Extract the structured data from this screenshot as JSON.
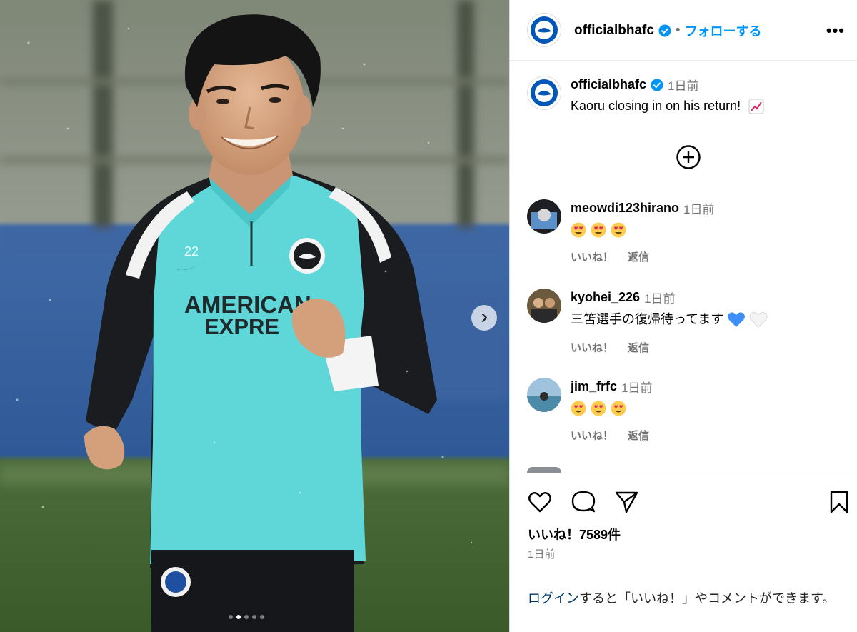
{
  "colors": {
    "accent": "#0095f6",
    "muted": "#737373",
    "link": "#00376b",
    "jersey_teal": "#5fd6d8",
    "brighton_blue": "#0057b8"
  },
  "post": {
    "carousel": {
      "dot_count": 5,
      "active_index": 1
    },
    "jersey_number": "22",
    "sponsor_line1": "AMERICAN",
    "sponsor_line2": "EXPRE",
    "header": {
      "username": "officialbhafc",
      "separator": "•",
      "follow_label": "フォローする",
      "more_label": "•••"
    },
    "caption": {
      "username": "officialbhafc",
      "time": "1日前",
      "text": "Kaoru closing in on his return!",
      "emoji_icon": "chart-increasing-icon"
    },
    "comments": [
      {
        "username": "meowdi123hirano",
        "time": "1日前",
        "text": "",
        "emoji_count": 3,
        "like_label": "いいね！",
        "reply_label": "返信"
      },
      {
        "username": "kyohei_226",
        "time": "1日前",
        "text": "三笘選手の復帰待ってます",
        "hearts": [
          "blue-heart-icon",
          "white-heart-icon"
        ],
        "like_label": "いいね！",
        "reply_label": "返信"
      },
      {
        "username": "jim_frfc",
        "time": "1日前",
        "text": "",
        "emoji_count": 3,
        "like_label": "いいね！",
        "reply_label": "返信"
      }
    ],
    "likes_text": "いいね！7589件",
    "date_text": "1日前",
    "login_link": "ログイン",
    "login_rest": "すると「いいね！」やコメントができます。"
  }
}
